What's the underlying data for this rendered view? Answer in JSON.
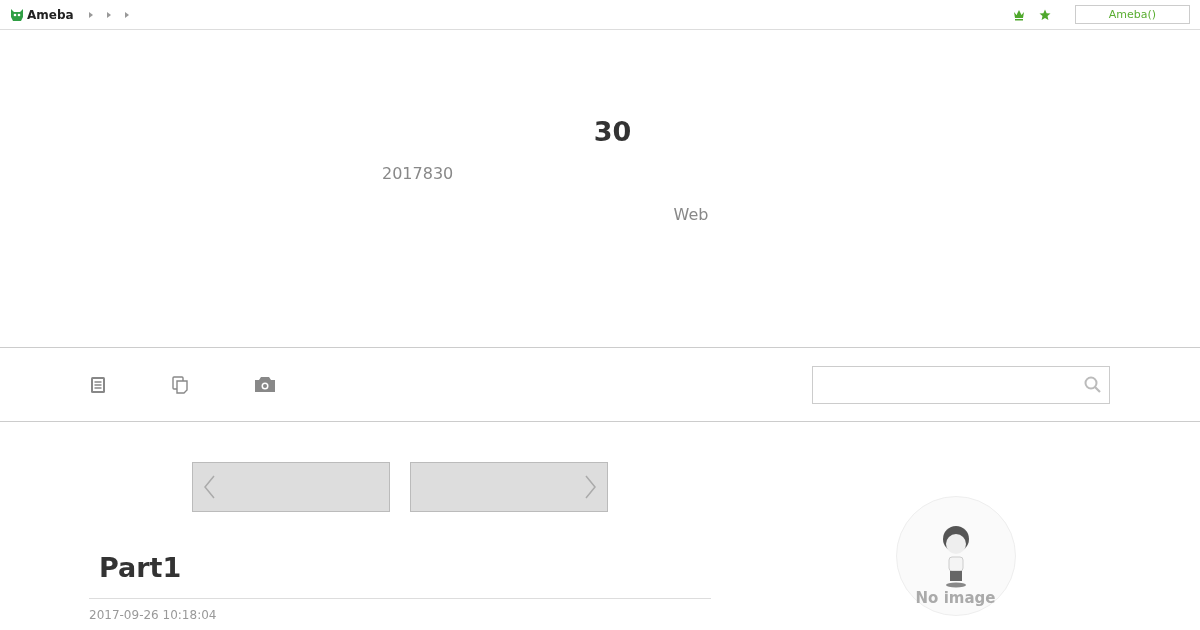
{
  "header": {
    "logo": "Ameba",
    "account_button": "Ameba()"
  },
  "hero": {
    "title": "30",
    "subtitle": "2017830",
    "description": "Web"
  },
  "pager": {
    "prev_enabled": true,
    "next_enabled": true
  },
  "entry": {
    "title": "Part1",
    "date": "2017-09-26 10:18:04"
  },
  "profile": {
    "caption": "No image"
  }
}
